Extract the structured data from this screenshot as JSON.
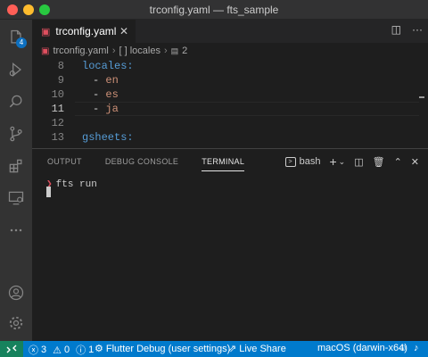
{
  "window": {
    "title": "trconfig.yaml — fts_sample"
  },
  "activity_bar": {
    "items": [
      {
        "name": "explorer",
        "icon": "files-icon",
        "badge": "4"
      },
      {
        "name": "run-debug",
        "icon": "run-debug-icon"
      },
      {
        "name": "search",
        "icon": "search-icon"
      },
      {
        "name": "source-control",
        "icon": "source-control-icon"
      },
      {
        "name": "extensions",
        "icon": "extensions-icon"
      },
      {
        "name": "remote-explorer",
        "icon": "remote-explorer-icon"
      },
      {
        "name": "more",
        "icon": "ellipsis-icon"
      }
    ],
    "bottom": [
      {
        "name": "accounts",
        "icon": "account-icon"
      },
      {
        "name": "manage",
        "icon": "gear-icon"
      }
    ]
  },
  "editor_tab": {
    "label": "trconfig.yaml",
    "icon": "yaml-icon"
  },
  "breadcrumb": {
    "file": "trconfig.yaml",
    "segment1": "[ ] locales",
    "segment2": "2"
  },
  "editor": {
    "lines": [
      {
        "number": "8",
        "key": "locales:"
      },
      {
        "number": "9",
        "dash": "- ",
        "value": "en"
      },
      {
        "number": "10",
        "dash": "- ",
        "value": "es"
      },
      {
        "number": "11",
        "dash": "- ",
        "value": "ja",
        "active": true
      },
      {
        "number": "12"
      },
      {
        "number": "13",
        "key": "gsheets:"
      }
    ]
  },
  "panel": {
    "tabs": [
      "OUTPUT",
      "DEBUG CONSOLE",
      "TERMINAL"
    ],
    "active_tab": "TERMINAL",
    "terminal_name": "bash",
    "command": "fts run"
  },
  "status_bar": {
    "errors": "3",
    "warnings": "0",
    "info": "1",
    "flutter": "Flutter Debug (user settings)",
    "live_share": "Live Share",
    "device": "macOS (darwin-x64)"
  },
  "colors": {
    "status_bar": "#007acc",
    "remote_indicator": "#16825d",
    "activity_bar": "#333333",
    "editor_bg": "#1e1e1e",
    "yaml_key": "#569cd6",
    "yaml_value": "#ce9178",
    "badge": "#0e70c0"
  }
}
